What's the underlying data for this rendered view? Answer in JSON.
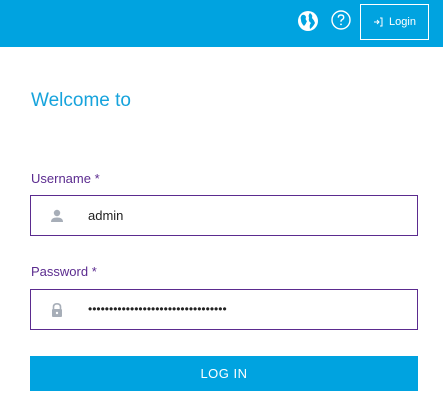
{
  "header": {
    "language_icon": "globe-icon",
    "help_icon": "help-circle-icon",
    "login_label": "Login",
    "login_icon": "login-arrow-icon",
    "background_color": "#00a3e0"
  },
  "form": {
    "title": "Welcome to",
    "username_label": "Username *",
    "username_value": "admin",
    "username_icon": "person-icon",
    "password_label": "Password *",
    "password_value": "•••••••••••••••••••••••••••••••••",
    "password_icon": "lock-icon",
    "submit_label": "LOG IN"
  },
  "colors": {
    "accent": "#00a3e0",
    "label": "#5b2b8f",
    "title": "#16a3dc",
    "icon": "#a7aeb8"
  }
}
